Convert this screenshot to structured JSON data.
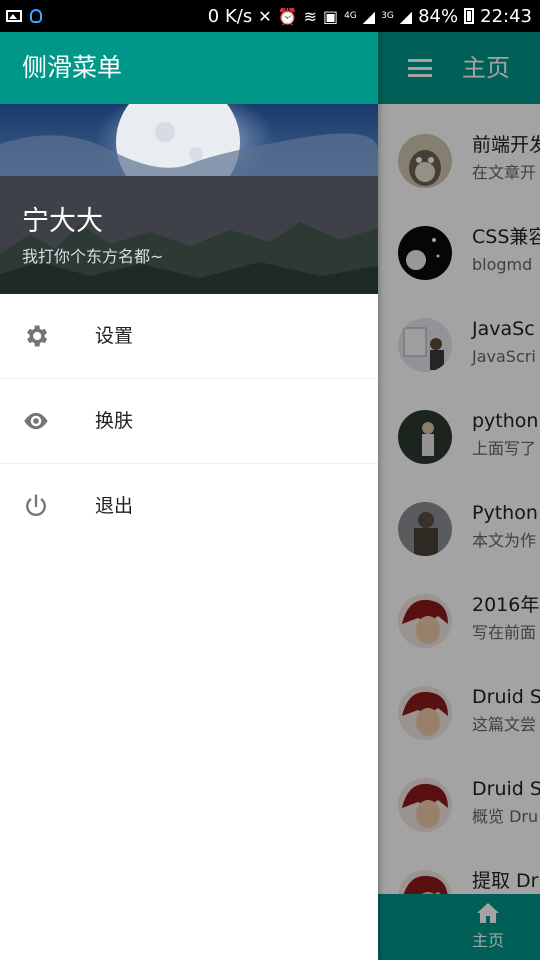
{
  "status_bar": {
    "speed": "0 K/s",
    "network_4g": "4G",
    "network_3g": "3G",
    "battery": "84%",
    "time": "22:43"
  },
  "drawer": {
    "title": "侧滑菜单",
    "user_name": "宁大大",
    "signature": "我打你个东方名都~",
    "menu": [
      {
        "label": "设置",
        "icon": "gear-icon"
      },
      {
        "label": "换肤",
        "icon": "eye-icon"
      },
      {
        "label": "退出",
        "icon": "power-icon"
      }
    ]
  },
  "toolbar": {
    "title": "主页"
  },
  "list": [
    {
      "title": "前端开发",
      "subtitle": "在文章开"
    },
    {
      "title": "CSS兼容",
      "subtitle": "blogmd"
    },
    {
      "title": "JavaSc",
      "subtitle": "JavaScri"
    },
    {
      "title": "python",
      "subtitle": "上面写了"
    },
    {
      "title": "Python",
      "subtitle": "本文为作"
    },
    {
      "title": "2016年",
      "subtitle": "写在前面"
    },
    {
      "title": "Druid S",
      "subtitle": "这篇文尝"
    },
    {
      "title": "Druid S",
      "subtitle": "概览 Dru"
    },
    {
      "title": "提取 Dru",
      "subtitle": ""
    }
  ],
  "bottom_nav": {
    "home_label": "主页",
    "home_icon": "home-icon"
  },
  "colors": {
    "primary": "#009688",
    "scrim": "rgba(0,0,0,0.36)"
  }
}
